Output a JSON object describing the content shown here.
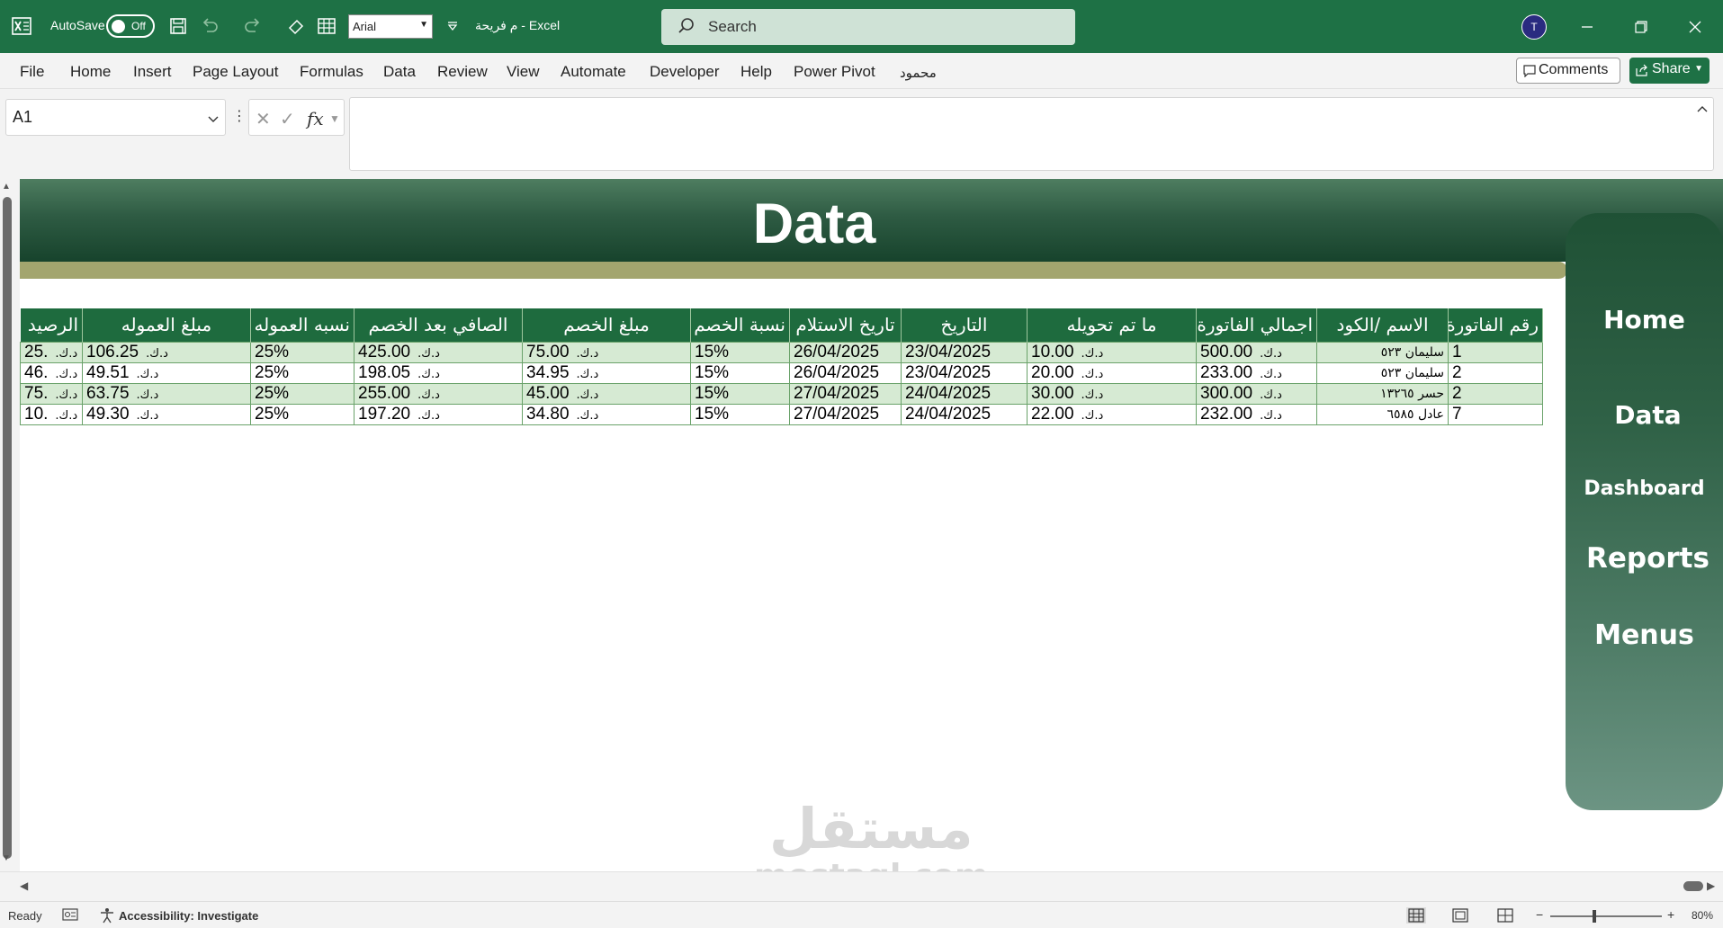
{
  "titlebar": {
    "autosave_label": "AutoSave",
    "autosave_state": "Off",
    "font_name": "Arial",
    "doc_title": "م فريحة  -  Excel",
    "search_placeholder": "Search",
    "avatar_initial": "T"
  },
  "ribbon": {
    "tabs": [
      "File",
      "Home",
      "Insert",
      "Page Layout",
      "Formulas",
      "Data",
      "Review",
      "View",
      "Automate",
      "Developer",
      "Help",
      "Power Pivot",
      "محمود"
    ],
    "comments_label": "Comments",
    "share_label": "Share"
  },
  "formula_bar": {
    "name_box": "A1",
    "fx_label": "fx",
    "formula": ""
  },
  "sheet": {
    "banner_title": "Data",
    "nav": [
      "Home",
      "Data",
      "Dashboard",
      "Reports",
      "Menus"
    ],
    "table": {
      "headers": [
        "رقم الفاتورة",
        "الاسم /الكود",
        "اجمالي الفاتورة",
        "ما تم تحويله",
        "التاريخ",
        "تاريخ الاستلام",
        "نسبة الخصم",
        "مبلغ الخصم",
        "الصافي بعد الخصم",
        "نسبه العموله",
        "مبلغ العموله",
        "الرصيد"
      ],
      "currency": "د.ك.",
      "rows": [
        {
          "invoice": "1",
          "name": "سليمان ٥٢٣",
          "total": "500.00",
          "transferred": "10.00",
          "date": "23/04/2025",
          "received": "26/04/2025",
          "disc_rate": "15%",
          "disc_amount": "75.00",
          "net": "425.00",
          "comm_rate": "25%",
          "comm_amount": "106.25",
          "balance": ".25"
        },
        {
          "invoice": "2",
          "name": "سليمان ٥٢٣",
          "total": "233.00",
          "transferred": "20.00",
          "date": "23/04/2025",
          "received": "26/04/2025",
          "disc_rate": "15%",
          "disc_amount": "34.95",
          "net": "198.05",
          "comm_rate": "25%",
          "comm_amount": "49.51",
          "balance": ".46"
        },
        {
          "invoice": "2",
          "name": "حسر ١٣٢٦٥",
          "total": "300.00",
          "transferred": "30.00",
          "date": "24/04/2025",
          "received": "27/04/2025",
          "disc_rate": "15%",
          "disc_amount": "45.00",
          "net": "255.00",
          "comm_rate": "25%",
          "comm_amount": "63.75",
          "balance": ".75"
        },
        {
          "invoice": "7",
          "name": "عادل ٦٥٨٥",
          "total": "232.00",
          "transferred": "22.00",
          "date": "24/04/2025",
          "received": "27/04/2025",
          "disc_rate": "15%",
          "disc_amount": "34.80",
          "net": "197.20",
          "comm_rate": "25%",
          "comm_amount": "49.30",
          "balance": ".10"
        }
      ]
    },
    "watermark": {
      "arabic": "مستقل",
      "latin": "mostaql.com"
    }
  },
  "status_bar": {
    "ready": "Ready",
    "accessibility": "Accessibility: Investigate",
    "zoom": "80%"
  },
  "colors": {
    "excel_green": "#1e7145",
    "header_green": "#1e6b3e",
    "row_band": "#d6ead3",
    "olive": "#a3a56e"
  }
}
